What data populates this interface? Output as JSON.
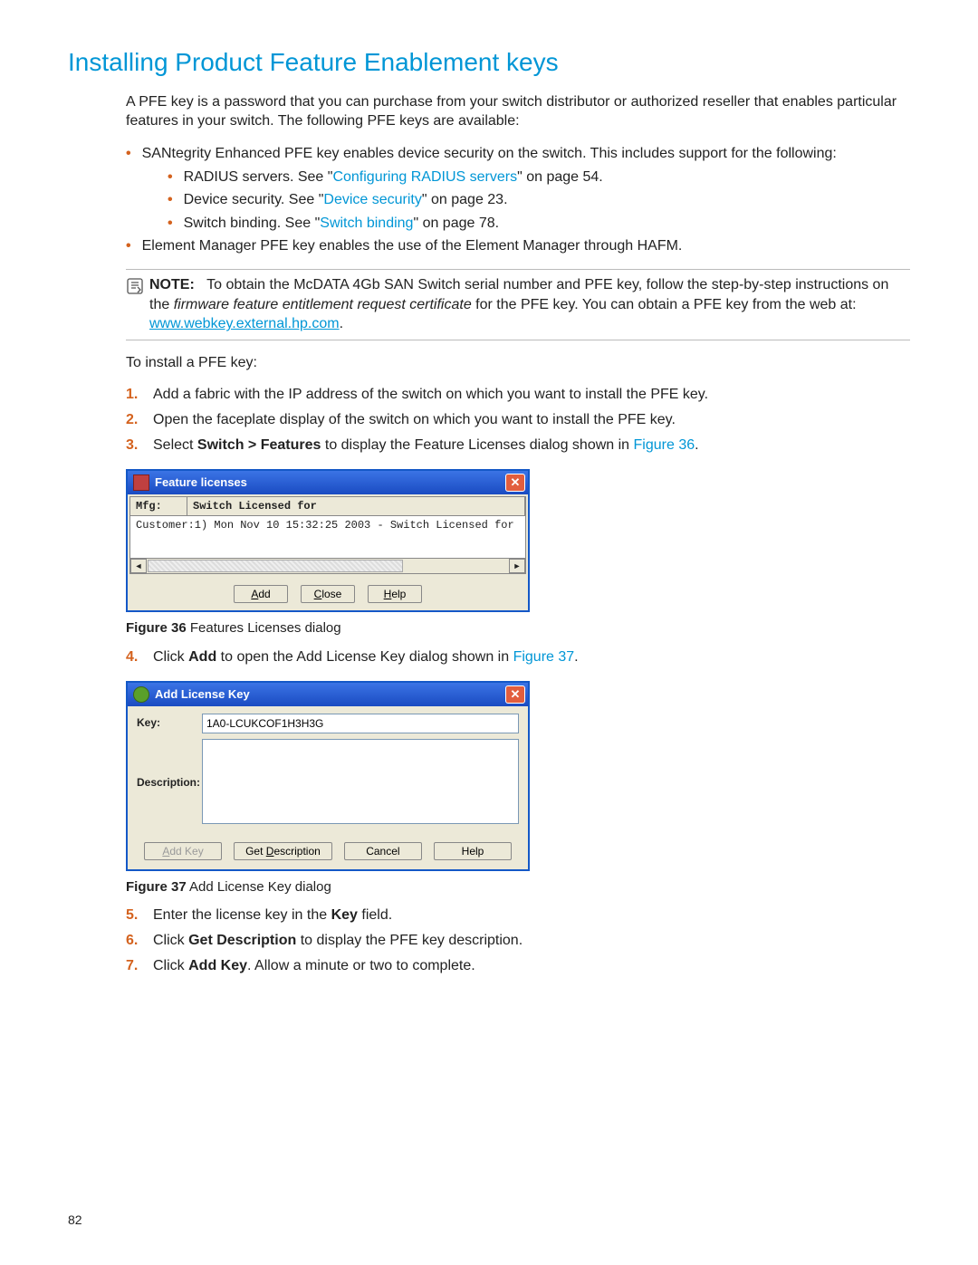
{
  "heading": "Installing Product Feature Enablement keys",
  "intro": "A PFE key is a password that you can purchase from your switch distributor or authorized reseller that enables particular features in your switch. The following PFE keys are available:",
  "l1a": "SANtegrity Enhanced PFE key enables device security on the switch. This includes support for the following:",
  "l2a_pre": "RADIUS servers. See \"",
  "l2a_link": "Configuring RADIUS servers",
  "l2a_post": "\" on page 54.",
  "l2b_pre": "Device security. See \"",
  "l2b_link": "Device security",
  "l2b_post": "\" on page 23.",
  "l2c_pre": "Switch binding. See \"",
  "l2c_link": "Switch binding",
  "l2c_post": "\" on page 78.",
  "l1b": "Element Manager PFE key enables the use of the Element Manager through HAFM.",
  "note_label": "NOTE:",
  "note_t1": "To obtain the McDATA 4Gb SAN Switch serial number and PFE key, follow the step-by-step instructions on the ",
  "note_italic": "firmware feature entitlement request certificate",
  "note_t2": " for the PFE key. You can obtain a PFE key from the web at: ",
  "note_url": "www.webkey.external.hp.com",
  "note_t3": ".",
  "install_lead": "To install a PFE key:",
  "step1": "Add a fabric with the IP address of the switch on which you want to install the PFE key.",
  "step2": "Open the faceplate display of the switch on which you want to install the PFE key.",
  "step3a": "Select ",
  "step3b": "Switch > Features",
  "step3c": " to display the Feature Licenses dialog shown in ",
  "step3link": "Figure 36",
  "step3d": ".",
  "fig36_label": "Figure 36",
  "fig36_caption": "  Features Licenses dialog",
  "step4a": "Click ",
  "step4b": "Add",
  "step4c": " to open the Add License Key dialog shown in ",
  "step4link": "Figure 37",
  "step4d": ".",
  "fig37_label": "Figure 37",
  "fig37_caption": "  Add License Key dialog",
  "step5a": "Enter the license key in the ",
  "step5b": "Key",
  "step5c": " field.",
  "step6a": "Click ",
  "step6b": "Get Description",
  "step6c": " to display the PFE key description.",
  "step7a": "Click ",
  "step7b": "Add Key",
  "step7c": ". Allow a minute or two to complete.",
  "page_number": "82",
  "dialog1": {
    "title": "Feature licenses",
    "col1": "Mfg:",
    "col2": "Switch Licensed for",
    "row": "Customer:1) Mon Nov 10 15:32:25 2003 - Switch Licensed for",
    "btn_add": "Add",
    "btn_close": "Close",
    "btn_help": "Help"
  },
  "dialog2": {
    "title": "Add License Key",
    "key_label": "Key:",
    "key_value": "1A0-LCUKCOF1H3H3G",
    "desc_label": "Description:",
    "btn_addkey": "Add Key",
    "btn_getdesc": "Get Description",
    "btn_cancel": "Cancel",
    "btn_help": "Help"
  }
}
